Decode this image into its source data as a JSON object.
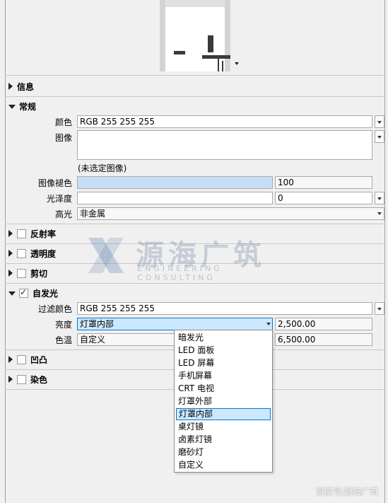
{
  "sections": {
    "info": "信息",
    "general": "常规",
    "reflectivity": "反射率",
    "transparency": "透明度",
    "cutout": "剪切",
    "self_illumination": "自发光",
    "bump": "凹凸",
    "tint": "染色"
  },
  "general": {
    "color_label": "颜色",
    "color_value": "RGB 255 255 255",
    "image_label": "图像",
    "image_status": "(未选定图像)",
    "image_fade_label": "图像褪色",
    "image_fade_value": "100",
    "image_fade_fraction": 1.0,
    "glossiness_label": "光泽度",
    "glossiness_value": "0",
    "highlights_label": "高光",
    "highlights_value": "非金属"
  },
  "self_illumination": {
    "checked": true,
    "filter_color_label": "过滤颜色",
    "filter_color_value": "RGB 255 255 255",
    "luminance_label": "亮度",
    "luminance_selected": "灯罩内部",
    "luminance_value": "2,500.00",
    "color_temp_label": "色温",
    "color_temp_selected": "自定义",
    "color_temp_value": "6,500.00"
  },
  "luminance_options": [
    "暗发光",
    "LED 面板",
    "LED 屏幕",
    "手机屏幕",
    "CRT 电视",
    "灯罩外部",
    "灯罩内部",
    "桌灯镜",
    "卤素灯镜",
    "磨砂灯",
    "自定义"
  ],
  "selected_option_index": 6,
  "watermark": {
    "chinese": "源海广筑",
    "english": "ENGINEERING CONSULTING"
  },
  "credit": "百家号/源海广筑",
  "colors": {
    "panel_bg": "#f0f0f0",
    "selection_bg": "#cce8ff",
    "selection_border": "#0078d7",
    "fade_fill": "#c7dff5"
  }
}
